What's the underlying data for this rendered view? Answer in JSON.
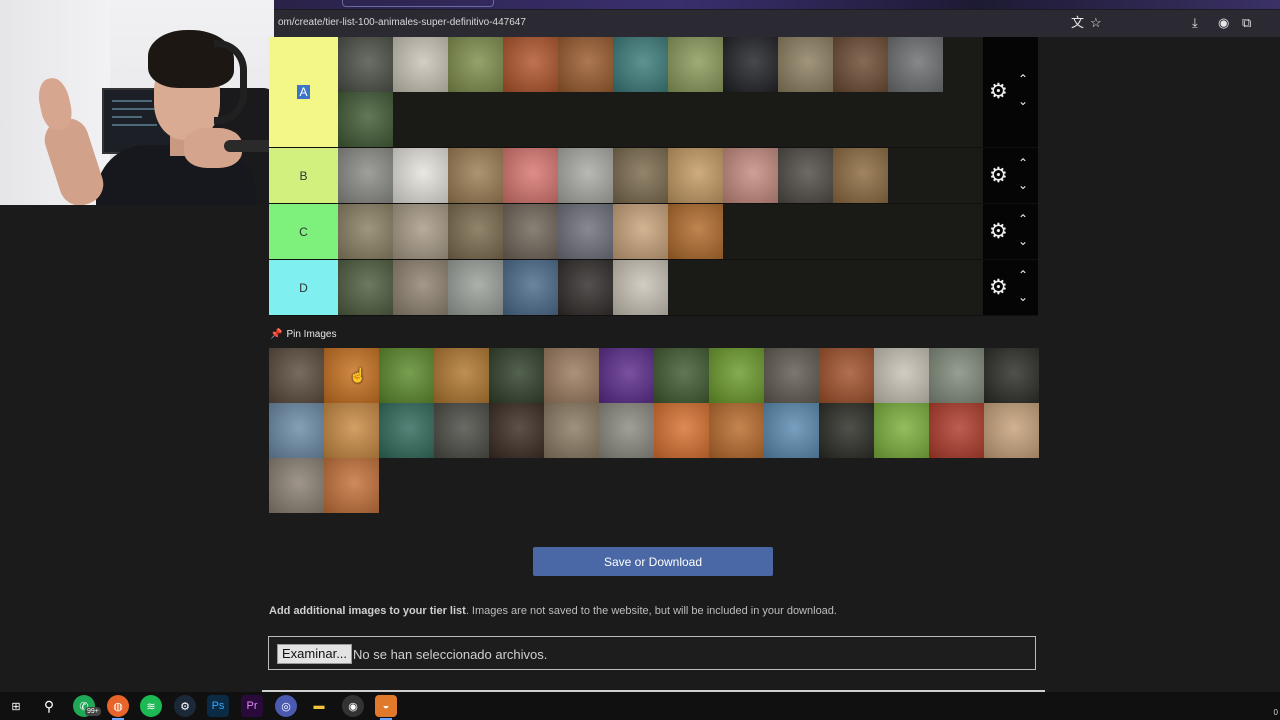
{
  "browser": {
    "url": "om/create/tier-list-100-animales-super-definitivo-447647"
  },
  "tiers": [
    {
      "label": "A",
      "color": "#f3f787",
      "highlighted": true,
      "items": [
        {
          "name": "gorilla",
          "color": "#4a4f45"
        },
        {
          "name": "cow",
          "color": "#c9c4b7"
        },
        {
          "name": "grasshopper",
          "color": "#7f8e4c"
        },
        {
          "name": "rooster",
          "color": "#b0542a"
        },
        {
          "name": "deer",
          "color": "#9a5a2c"
        },
        {
          "name": "seahorse",
          "color": "#3a7b7a"
        },
        {
          "name": "snail",
          "color": "#8a9a5a"
        },
        {
          "name": "crow",
          "color": "#1e2024"
        },
        {
          "name": "sloth",
          "color": "#8c7f60"
        },
        {
          "name": "bear",
          "color": "#6b4a32"
        },
        {
          "name": "wolf",
          "color": "#6b6e70"
        },
        {
          "name": "duck",
          "color": "#3f5a33"
        }
      ]
    },
    {
      "label": "B",
      "color": "#d2f07e",
      "highlighted": false,
      "items": [
        {
          "name": "koala",
          "color": "#8a8a85"
        },
        {
          "name": "eagle",
          "color": "#e6e3dc"
        },
        {
          "name": "giraffe",
          "color": "#9b7c52"
        },
        {
          "name": "flamingo",
          "color": "#d8756f"
        },
        {
          "name": "zebra",
          "color": "#a9a9a4"
        },
        {
          "name": "wildebeest",
          "color": "#7b6a4c"
        },
        {
          "name": "camel",
          "color": "#c49a62"
        },
        {
          "name": "pig",
          "color": "#c48a7e"
        },
        {
          "name": "mole",
          "color": "#4e4a45"
        },
        {
          "name": "toad",
          "color": "#8c6a3f"
        }
      ]
    },
    {
      "label": "C",
      "color": "#7ef07c",
      "highlighted": false,
      "items": [
        {
          "name": "snake",
          "color": "#8a7f62"
        },
        {
          "name": "spider",
          "color": "#a79a86"
        },
        {
          "name": "hyena",
          "color": "#7a6a4c"
        },
        {
          "name": "vulture",
          "color": "#6f6458"
        },
        {
          "name": "baboon",
          "color": "#6d6f7a"
        },
        {
          "name": "hamster",
          "color": "#c9a37a"
        },
        {
          "name": "lion",
          "color": "#b06a2a"
        }
      ]
    },
    {
      "label": "D",
      "color": "#7fefef",
      "highlighted": false,
      "items": [
        {
          "name": "turtle",
          "color": "#4d5c3e"
        },
        {
          "name": "scorpion",
          "color": "#8f8270"
        },
        {
          "name": "lizard",
          "color": "#9aa09a"
        },
        {
          "name": "seagull",
          "color": "#4a6a8a"
        },
        {
          "name": "chimpanzee",
          "color": "#2e2a28"
        },
        {
          "name": "cockroach",
          "color": "#c9c2b5"
        }
      ]
    }
  ],
  "pin_section": {
    "title": "Pin Images",
    "icon": "pin-icon"
  },
  "pool": [
    {
      "name": "platypus",
      "color": "#5a4a3c"
    },
    {
      "name": "butterfly",
      "color": "#c7701e"
    },
    {
      "name": "ladybug",
      "color": "#5a8a2a"
    },
    {
      "name": "mealworms",
      "color": "#b0772e"
    },
    {
      "name": "magpie",
      "color": "#2f3f2a"
    },
    {
      "name": "owl",
      "color": "#9a7a5e"
    },
    {
      "name": "jellyfish",
      "color": "#5a2a8a"
    },
    {
      "name": "skunk",
      "color": "#3f5a2e"
    },
    {
      "name": "fly",
      "color": "#6a9a2a"
    },
    {
      "name": "otter",
      "color": "#5f5a50"
    },
    {
      "name": "orangutan",
      "color": "#a0502a"
    },
    {
      "name": "sheep",
      "color": "#c7c2b5"
    },
    {
      "name": "pigeon",
      "color": "#7f8a7a"
    },
    {
      "name": "panther",
      "color": "#2a2a26"
    },
    {
      "name": "pelican",
      "color": "#6a8aa5"
    },
    {
      "name": "golden-retriever",
      "color": "#c98a42"
    },
    {
      "name": "peacock",
      "color": "#2f6a5a"
    },
    {
      "name": "boar",
      "color": "#4a4a44"
    },
    {
      "name": "horse",
      "color": "#3a2a22"
    },
    {
      "name": "rhino",
      "color": "#8a7a62"
    },
    {
      "name": "seal",
      "color": "#8a8a80"
    },
    {
      "name": "clownfish",
      "color": "#d8702e"
    },
    {
      "name": "tiger",
      "color": "#b86a2a"
    },
    {
      "name": "shark",
      "color": "#5a8ab0"
    },
    {
      "name": "buffalo",
      "color": "#2a2a24"
    },
    {
      "name": "mantis",
      "color": "#7ab03a"
    },
    {
      "name": "macaw",
      "color": "#b03a2a"
    },
    {
      "name": "ostrich",
      "color": "#c7a27a"
    },
    {
      "name": "cat",
      "color": "#8a7f72"
    },
    {
      "name": "fox",
      "color": "#c47038"
    }
  ],
  "save_button": {
    "label": "Save or Download"
  },
  "add_images": {
    "bold": "Add additional images to your tier list",
    "rest": ". Images are not saved to the website, but will be included in your download."
  },
  "file_input": {
    "button_label": "Examinar...",
    "status": "No se han seleccionado archivos."
  },
  "taskbar": {
    "whatsapp_badge": "99+",
    "clock_fragment": "0"
  }
}
